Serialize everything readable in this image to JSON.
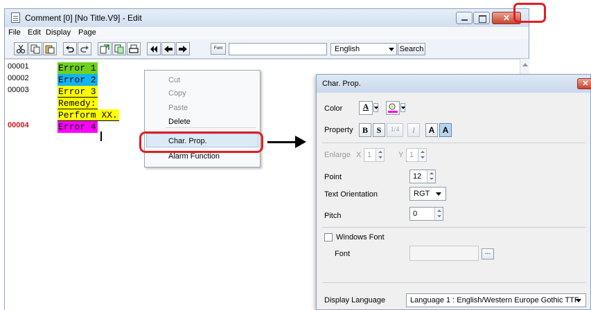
{
  "window": {
    "title": "Comment [0] [No Title.V9] - Edit",
    "close_glyph": "✕"
  },
  "menu": [
    "File",
    "Edit",
    "Display",
    "Page"
  ],
  "toolbar": {
    "font_label": "Font",
    "language_value": "English",
    "search_label": "Search",
    "icons": [
      "cut-icon",
      "copy-icon",
      "paste-icon",
      "undo-icon",
      "redo-icon",
      "import-icon",
      "export-icon",
      "print-icon",
      "first-page-icon",
      "prev-page-icon",
      "next-page-icon"
    ]
  },
  "editor": {
    "lines": [
      {
        "no": "00001",
        "text": "Error 1",
        "bg": "#6fd11e",
        "red": false
      },
      {
        "no": "00002",
        "text": "Error 2",
        "bg": "#10b4f2",
        "red": false
      },
      {
        "no": "00003",
        "text": "Error 3",
        "bg": "#ffff00",
        "red": false
      },
      {
        "no": "",
        "text": "Remedy:",
        "bg": "#ffff00",
        "red": false
      },
      {
        "no": "",
        "text": "Perform XX.",
        "bg": "#ffff00",
        "red": false
      },
      {
        "no": "00004",
        "text": "Error 4",
        "bg": "#ff00ff",
        "red": true
      }
    ]
  },
  "context_menu": {
    "items": [
      {
        "label": "Cut",
        "enabled": false
      },
      {
        "label": "Copy",
        "enabled": false
      },
      {
        "label": "Paste",
        "enabled": false
      },
      {
        "label": "Delete",
        "enabled": true
      },
      {
        "label": "Char. Prop.",
        "enabled": true
      },
      {
        "label": "Alarm Function",
        "enabled": true
      }
    ]
  },
  "dialog": {
    "title": "Char. Prop.",
    "close_glyph": "✕",
    "color_label": "Color",
    "text_color_glyph": "A",
    "property_label": "Property",
    "property_buttons": [
      "B",
      "S",
      "1/4",
      "I",
      "A",
      "A"
    ],
    "enlarge_label": "Enlarge",
    "enlarge_x_label": "X",
    "enlarge_x_value": "1",
    "enlarge_y_label": "Y",
    "enlarge_y_value": "1",
    "point_label": "Point",
    "point_value": "12",
    "orientation_label": "Text Orientation",
    "orientation_value": "RGT",
    "pitch_label": "Pitch",
    "pitch_value": "0",
    "windows_font_label": "Windows Font",
    "windows_font_checked": false,
    "font_label": "Font",
    "font_value": "",
    "font_browse_label": "...",
    "display_language_label": "Display Language",
    "display_language_value": "Language 1 : English/Western Europe Gothic TTF"
  }
}
